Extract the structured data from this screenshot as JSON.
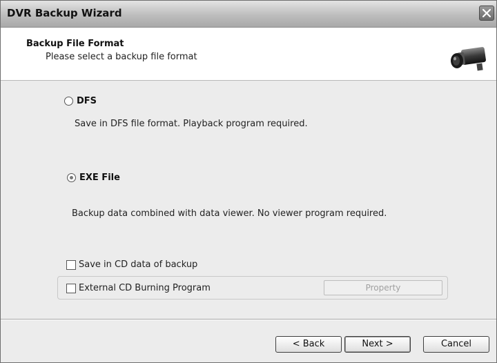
{
  "window": {
    "title": "DVR Backup Wizard"
  },
  "header": {
    "title": "Backup File Format",
    "subtitle": "Please select a backup file format",
    "icon": "camera-icon"
  },
  "format_options": [
    {
      "label": "DFS",
      "selected": false,
      "description": "Save in DFS file format. Playback program required."
    },
    {
      "label": "EXE File",
      "selected": true,
      "description": "Backup data combined with data viewer. No viewer program required."
    }
  ],
  "options": {
    "save_cd_label": "Save in CD data of backup",
    "save_cd_checked": false,
    "external_cd_label": "External CD Burning Program",
    "external_cd_checked": false,
    "property_label": "Property"
  },
  "buttons": {
    "back": "< Back",
    "next": "Next >",
    "cancel": "Cancel"
  }
}
